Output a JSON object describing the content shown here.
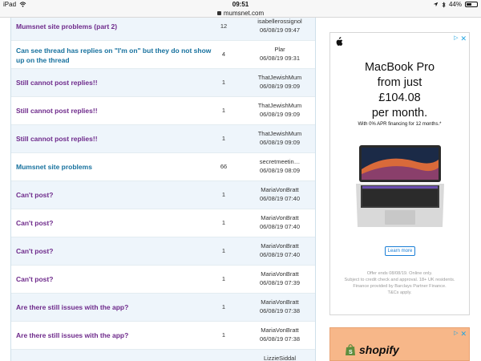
{
  "statusbar": {
    "device": "iPad",
    "time": "09:51",
    "battery": "44%"
  },
  "urlbar": {
    "url": "mumsnet.com"
  },
  "threads": [
    {
      "title": "Mumsnet site problems (part 2)",
      "color": "purple",
      "count": "12",
      "user": "isabellerossignol",
      "date": "06/08/19 09:47"
    },
    {
      "title": "Can see thread has replies on \"I'm on\" but they do not show up on the thread",
      "color": "blue",
      "count": "4",
      "user": "Plar",
      "date": "06/08/19 09:31"
    },
    {
      "title": "Still cannot post replies!!",
      "color": "purple",
      "count": "1",
      "user": "ThatJewishMum",
      "date": "06/08/19 09:09"
    },
    {
      "title": "Still cannot post replies!!",
      "color": "purple",
      "count": "1",
      "user": "ThatJewishMum",
      "date": "06/08/19 09:09"
    },
    {
      "title": "Still cannot post replies!!",
      "color": "purple",
      "count": "1",
      "user": "ThatJewishMum",
      "date": "06/08/19 09:09"
    },
    {
      "title": "Mumsnet site problems",
      "color": "blue",
      "count": "66",
      "user": "secretmeetin…",
      "date": "06/08/19 08:09"
    },
    {
      "title": "Can't post?",
      "color": "purple",
      "count": "1",
      "user": "MariaVonBratt",
      "date": "06/08/19 07:40"
    },
    {
      "title": "Can't post?",
      "color": "purple",
      "count": "1",
      "user": "MariaVonBratt",
      "date": "06/08/19 07:40"
    },
    {
      "title": "Can't post?",
      "color": "purple",
      "count": "1",
      "user": "MariaVonBratt",
      "date": "06/08/19 07:40"
    },
    {
      "title": "Can't post?",
      "color": "purple",
      "count": "1",
      "user": "MariaVonBratt",
      "date": "06/08/19 07:39"
    },
    {
      "title": "Are there still issues with the app?",
      "color": "purple",
      "count": "1",
      "user": "MariaVonBratt",
      "date": "06/08/19 07:38"
    },
    {
      "title": "Are there still issues with the app?",
      "color": "purple",
      "count": "1",
      "user": "MariaVonBratt",
      "date": "06/08/19 07:38"
    },
    {
      "title": "",
      "color": "purple",
      "count": "",
      "user": "LizzieSiddal",
      "date": ""
    }
  ],
  "ad_macbook": {
    "line1": "MacBook Pro",
    "line2": "from just",
    "line3": "£104.08",
    "line4": "per month.",
    "subline": "With 0% APR financing for 12 months.*",
    "button": "Learn more",
    "fine1": "Offer ends 08/08/19. Online only.",
    "fine2": "Subject to credit check and approval. 18+ UK residents.",
    "fine3": "Finance provided by Barclays Partner Finance.",
    "fine4": "T&Cs apply."
  },
  "ad_shopify": {
    "brand": "shopify"
  },
  "colors": {
    "purple": "#6e2a8b",
    "blue": "#17719e",
    "row_alt": "#eef5fb",
    "ad_link": "#1a7ed6",
    "shopify_bg": "#f7b789"
  },
  "icons": {
    "adchoices": "adchoices-icon",
    "close": "close-icon",
    "apple": "apple-logo-icon",
    "lock": "lock-icon",
    "wifi": "wifi-icon",
    "bag": "shopping-bag-icon"
  }
}
